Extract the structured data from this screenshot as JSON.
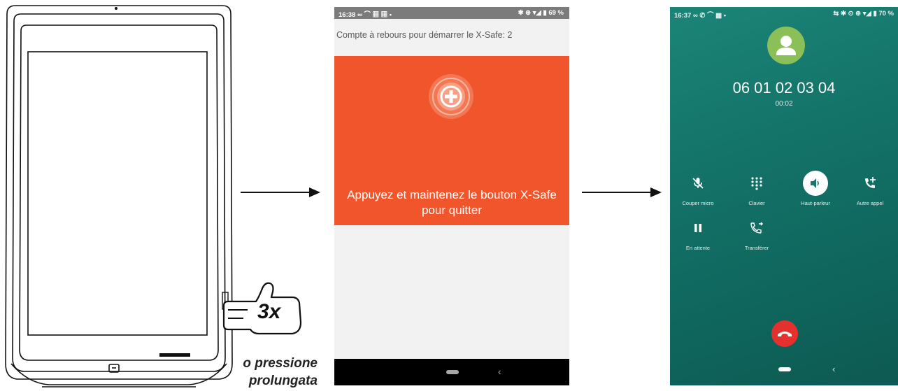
{
  "left_device": {
    "caption_3x": "3x",
    "caption_line1": "o pressione",
    "caption_line2": "prolungata"
  },
  "xsafe_screen": {
    "status_time": "16:38",
    "status_left_icons": "∞ ⌒ ▦ ▦ •",
    "status_right": "✱ ⊕ ▾◢ ▮ 69 %",
    "countdown_text": "Compte à rebours pour démarrer le X-Safe: 2",
    "exit_line1": "Appuyez et maintenez le bouton X-Safe",
    "exit_line2": "pour quitter",
    "accent_color": "#f0552b"
  },
  "call_screen": {
    "status_time": "16:37",
    "status_left_icons": "∞ ✆ ⌒ ▦ •",
    "status_right": "⇆ ✱ ⊙ ⊕ ▾◢ ▮ 70 %",
    "phone_number": "06 01 02 03 04",
    "call_timer": "00:02",
    "controls": [
      {
        "label": "Couper micro",
        "icon": "mic-off-icon"
      },
      {
        "label": "Clavier",
        "icon": "dialpad-icon"
      },
      {
        "label": "Haut-parleur",
        "icon": "speaker-icon"
      },
      {
        "label": "Autre appel",
        "icon": "add-call-icon"
      },
      {
        "label": "En attente",
        "icon": "pause-icon"
      },
      {
        "label": "Transférer",
        "icon": "transfer-call-icon"
      }
    ],
    "end_call_color": "#e5312e",
    "avatar_color": "#8ac057"
  }
}
